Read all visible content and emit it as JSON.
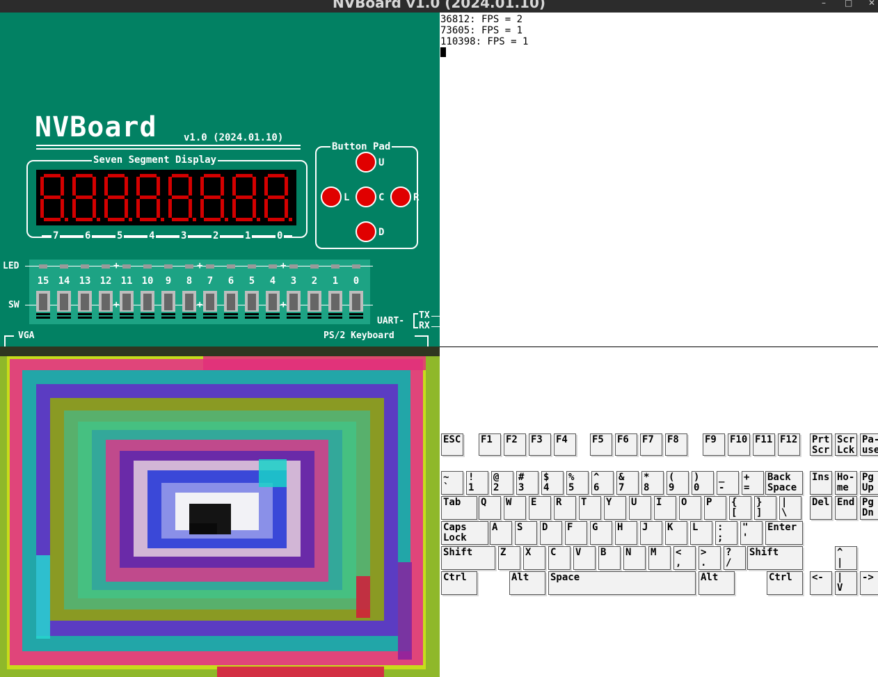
{
  "window": {
    "title": "NVBoard v1.0 (2024.01.10)",
    "min_icon": "–",
    "max_icon": "□",
    "close_icon": "✕"
  },
  "board": {
    "logo": "NVBoard",
    "version": "v1.0 (2024.01.10)",
    "seg_title": "Seven Segment Display",
    "seg_digit_labels": [
      "7",
      "6",
      "5",
      "4",
      "3",
      "2",
      "1",
      "0"
    ],
    "button_pad_title": "Button Pad",
    "buttons": {
      "up": "U",
      "left": "L",
      "center": "C",
      "right": "R",
      "down": "D"
    },
    "led_label": "LED",
    "sw_label": "SW",
    "numbers": [
      "15",
      "14",
      "13",
      "12",
      "11",
      "10",
      "9",
      "8",
      "7",
      "6",
      "5",
      "4",
      "3",
      "2",
      "1",
      "0"
    ],
    "uart_label": "UART-",
    "tx_label": "TX",
    "rx_label": "RX",
    "vga_label": "VGA",
    "ps2_label": "PS/2 Keyboard",
    "segment_color": "#d40000",
    "board_color": "#028163"
  },
  "terminal": {
    "lines": [
      "36812: FPS = 2",
      "73605: FPS = 1",
      "110398: FPS = 1"
    ]
  },
  "keyboard": {
    "rows": [
      [
        "ESC",
        "F1",
        "F2",
        "F3",
        "F4",
        "F5",
        "F6",
        "F7",
        "F8",
        "F9",
        "F10",
        "F11",
        "F12",
        "Prt\nScr",
        "Scr\nLck",
        "Pa-\nuse"
      ],
      [
        "~\n`",
        "!\n1",
        "@\n2",
        "#\n3",
        "$\n4",
        "%\n5",
        "^\n6",
        "&\n7",
        "*\n8",
        "(\n9",
        ")\n0",
        "_\n-",
        "+\n=",
        "Back\nSpace",
        "Ins",
        "Ho-\nme",
        "Pg\nUp"
      ],
      [
        "Tab",
        "Q",
        "W",
        "E",
        "R",
        "T",
        "Y",
        "U",
        "I",
        "O",
        "P",
        "{\n[",
        "}\n]",
        "|\n\\",
        "Del",
        "End",
        "Pg\nDn"
      ],
      [
        "Caps\nLock",
        "A",
        "S",
        "D",
        "F",
        "G",
        "H",
        "J",
        "K",
        "L",
        ":\n;",
        "\"\n'",
        "Enter"
      ],
      [
        "Shift",
        "Z",
        "X",
        "C",
        "V",
        "B",
        "N",
        "M",
        "<\n,",
        ">\n.",
        "?\n/",
        "Shift",
        "^\n|"
      ],
      [
        "Ctrl",
        "Alt",
        "Space",
        "Alt",
        "Ctrl",
        "<-",
        "|\nV",
        "->"
      ]
    ]
  }
}
